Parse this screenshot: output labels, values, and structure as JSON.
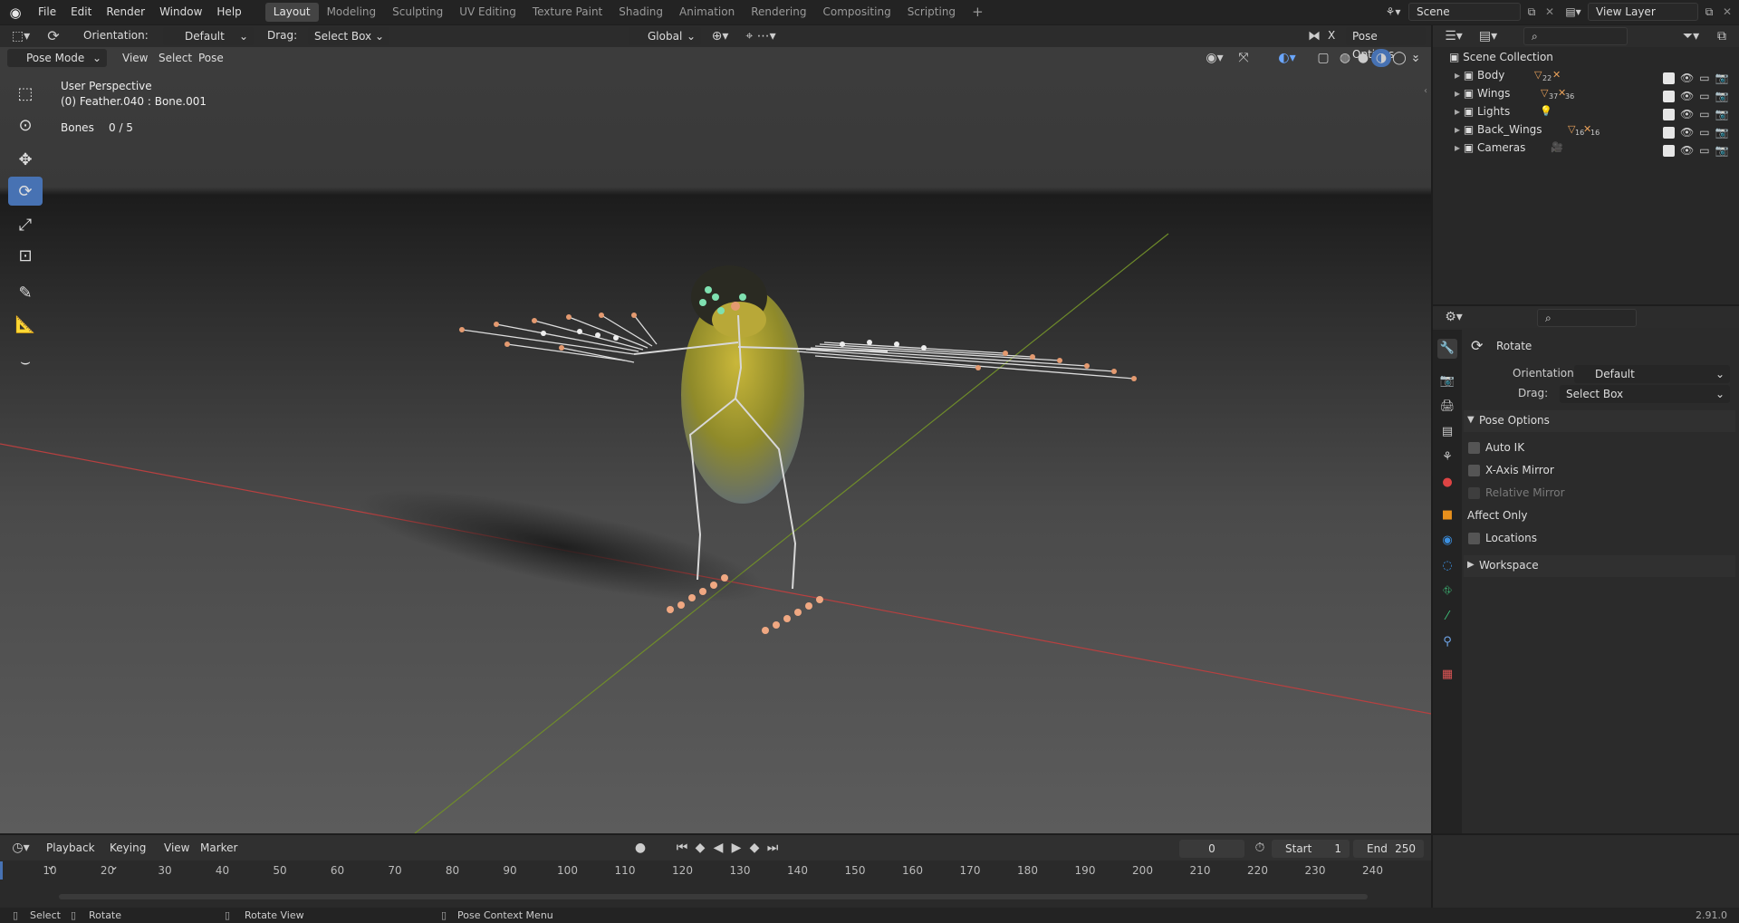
{
  "topbar": {
    "menus": [
      "File",
      "Edit",
      "Render",
      "Window",
      "Help"
    ],
    "workspaces": [
      "Layout",
      "Modeling",
      "Sculpting",
      "UV Editing",
      "Texture Paint",
      "Shading",
      "Animation",
      "Rendering",
      "Compositing",
      "Scripting"
    ],
    "active_workspace": "Layout",
    "add_tab": "+",
    "scene": "Scene",
    "view_layer": "View Layer"
  },
  "viewport_header": {
    "orientation_label": "Orientation:",
    "orientation_value": "Default",
    "drag_label": "Drag:",
    "drag_value": "Select Box",
    "transform_orientation": "Global",
    "x_label": "X",
    "pose_options": "Pose Options",
    "mode": "Pose Mode",
    "menus": [
      "View",
      "Select",
      "Pose"
    ]
  },
  "viewport": {
    "perspective": "User Perspective",
    "active": "(0) Feather.040 : Bone.001",
    "bones_label": "Bones",
    "bones_value": "0 / 5"
  },
  "outliner": {
    "root": "Scene Collection",
    "items": [
      {
        "name": "Body",
        "badge": "22"
      },
      {
        "name": "Wings",
        "badge": "37"
      },
      {
        "name": "Lights",
        "badge": ""
      },
      {
        "name": "Back_Wings",
        "badge": "16"
      },
      {
        "name": "Cameras",
        "badge": ""
      }
    ],
    "wings_badge2": "36",
    "back_wings_badge2": "16"
  },
  "properties": {
    "tool_name": "Rotate",
    "orientation_label": "Orientation",
    "orientation_value": "Default",
    "drag_label": "Drag:",
    "drag_value": "Select Box",
    "pose_options_header": "Pose Options",
    "auto_ik": "Auto IK",
    "x_axis_mirror": "X-Axis Mirror",
    "relative_mirror": "Relative Mirror",
    "affect_only": "Affect Only",
    "locations": "Locations",
    "workspace": "Workspace"
  },
  "timeline": {
    "menus": [
      "Playback",
      "Keying",
      "View",
      "Marker"
    ],
    "current_frame": "0",
    "start_label": "Start",
    "start_value": "1",
    "end_label": "End",
    "end_value": "250",
    "ticks": [
      "10",
      "20",
      "30",
      "40",
      "50",
      "60",
      "70",
      "80",
      "90",
      "100",
      "110",
      "120",
      "130",
      "140",
      "150",
      "160",
      "170",
      "180",
      "190",
      "200",
      "210",
      "220",
      "230",
      "240"
    ]
  },
  "statusbar": {
    "select": "Select",
    "rotate": "Rotate",
    "rotate_view": "Rotate View",
    "context_menu": "Pose Context Menu",
    "version": "2.91.0"
  },
  "colors": {
    "accent": "#4772b3",
    "x_axis": "#c83a3a",
    "y_axis": "#7a9a2e",
    "bone_orange": "#e28a5c",
    "bone_green": "#7fe0b0"
  }
}
